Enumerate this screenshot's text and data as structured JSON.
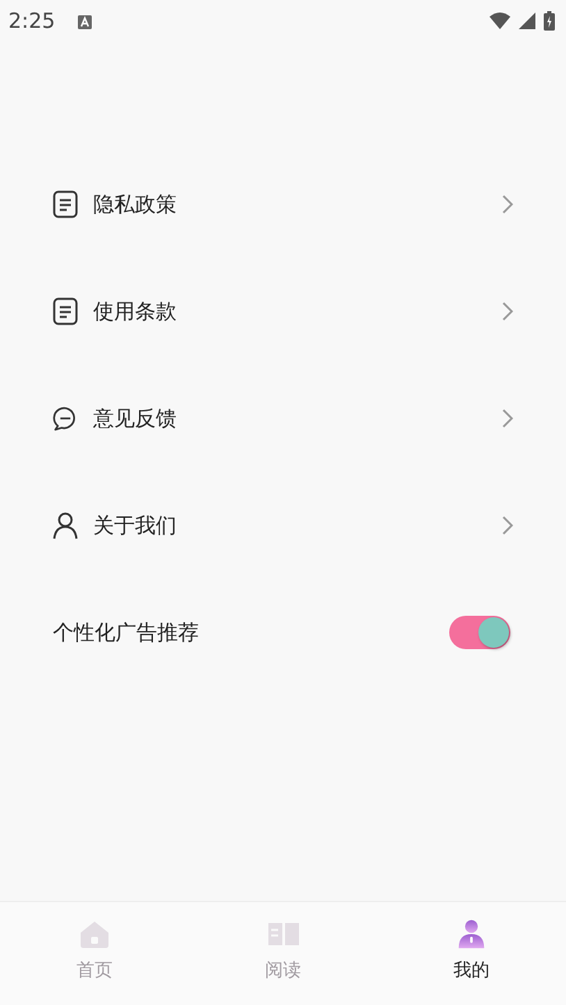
{
  "status_bar": {
    "time": "2:25"
  },
  "menu": [
    {
      "label": "隐私政策"
    },
    {
      "label": "使用条款"
    },
    {
      "label": "意见反馈"
    },
    {
      "label": "关于我们"
    }
  ],
  "ad_setting": {
    "label": "个性化广告推荐",
    "on": true
  },
  "tabs": [
    {
      "label": "首页",
      "selected": false
    },
    {
      "label": "阅读",
      "selected": false
    },
    {
      "label": "我的",
      "selected": true
    }
  ]
}
